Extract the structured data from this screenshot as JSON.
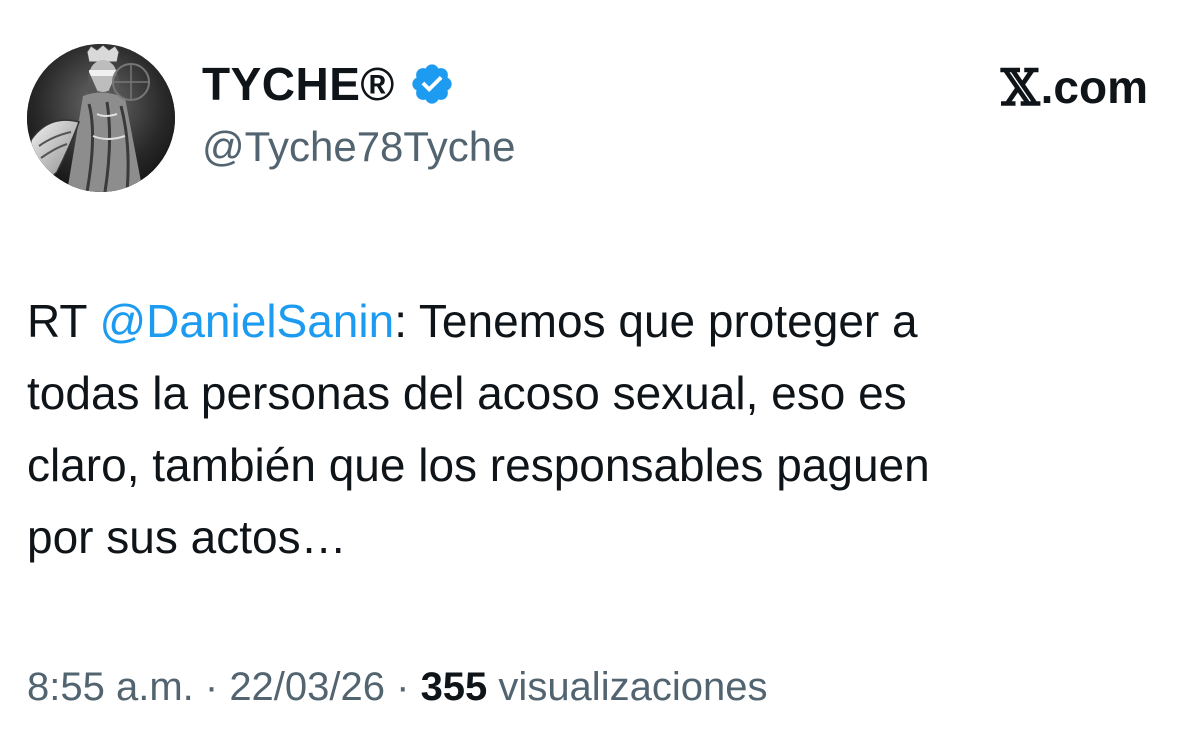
{
  "author": {
    "display_name": "TYCHE®",
    "handle": "@Tyche78Tyche",
    "verified": true,
    "avatar_icon": "avatar-justice-statue",
    "verified_color": "#1d9bf0"
  },
  "brand": {
    "label": ".com",
    "logo_glyph": "𝕏"
  },
  "tweet": {
    "prefix": "RT ",
    "mention": "@DanielSanin",
    "line1_rest": ": Tenemos que proteger a",
    "line2": "todas la personas del acoso sexual, eso es",
    "line3": "claro, también que los responsables paguen",
    "line4": "por sus actos…",
    "mention_color": "#1d9bf0"
  },
  "meta": {
    "time": "8:55 a.m.",
    "separator": " · ",
    "date": "22/03/26",
    "views_count": "355",
    "views_label": " visualizaciones"
  }
}
